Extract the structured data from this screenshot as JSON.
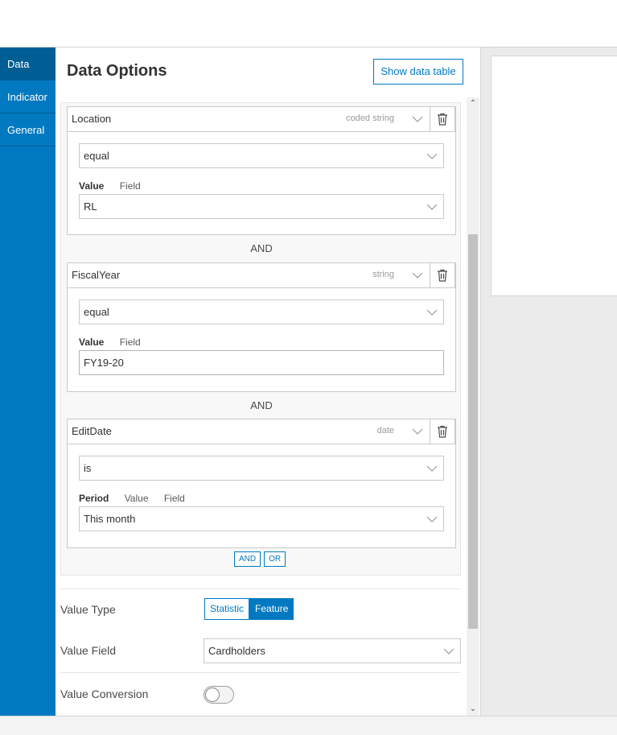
{
  "sidebar": {
    "items": [
      {
        "label": "Data"
      },
      {
        "label": "Indicator"
      },
      {
        "label": "General"
      }
    ]
  },
  "panel": {
    "title": "Data Options",
    "show_table_label": "Show data table"
  },
  "filters": {
    "conditions": [
      {
        "field": "Location",
        "type": "coded string",
        "operator": "equal",
        "modes": [
          "Value",
          "Field"
        ],
        "active_mode": "Value",
        "value": "RL",
        "value_is_dropdown": true
      },
      {
        "field": "FiscalYear",
        "type": "string",
        "operator": "equal",
        "modes": [
          "Value",
          "Field"
        ],
        "active_mode": "Value",
        "value": "FY19-20",
        "value_is_dropdown": false
      },
      {
        "field": "EditDate",
        "type": "date",
        "operator": "is",
        "modes": [
          "Period",
          "Value",
          "Field"
        ],
        "active_mode": "Period",
        "value": "This month",
        "value_is_dropdown": true
      }
    ],
    "joiners": [
      "AND",
      "AND"
    ],
    "add_and_label": "AND",
    "add_or_label": "OR"
  },
  "settings": {
    "value_type_label": "Value Type",
    "value_type_options": [
      "Statistic",
      "Feature"
    ],
    "value_type_selected": "Feature",
    "value_field_label": "Value Field",
    "value_field_value": "Cardholders",
    "value_conversion_label": "Value Conversion",
    "value_conversion_on": false
  },
  "colors": {
    "accent": "#0079c1",
    "sidebar_active": "#005e95"
  }
}
